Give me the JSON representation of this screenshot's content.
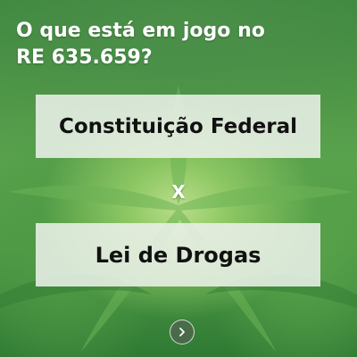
{
  "slide": {
    "title": "O que está em jogo no RE 635.659?",
    "top_box": "Constituição Federal",
    "versus": "X",
    "bottom_box": "Lei de Drogas"
  },
  "controls": {
    "next_icon": "chevron-right-icon"
  }
}
